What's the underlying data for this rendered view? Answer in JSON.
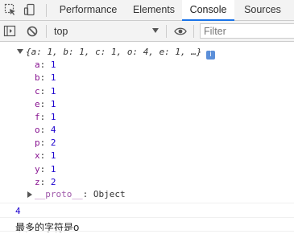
{
  "devtools": {
    "tabs": [
      {
        "label": "Performance"
      },
      {
        "label": "Elements"
      },
      {
        "label": "Console",
        "active": true
      },
      {
        "label": "Sources"
      }
    ]
  },
  "toolbar": {
    "context": "top",
    "filter_placeholder": "Filter"
  },
  "console": {
    "object_preview": "{a: 1, b: 1, c: 1, o: 4, e: 1, …}",
    "info_badge": "i",
    "properties": [
      {
        "key": "a",
        "value": "1"
      },
      {
        "key": "b",
        "value": "1"
      },
      {
        "key": "c",
        "value": "1"
      },
      {
        "key": "e",
        "value": "1"
      },
      {
        "key": "f",
        "value": "1"
      },
      {
        "key": "o",
        "value": "4"
      },
      {
        "key": "p",
        "value": "2"
      },
      {
        "key": "x",
        "value": "1"
      },
      {
        "key": "y",
        "value": "1"
      },
      {
        "key": "z",
        "value": "2"
      }
    ],
    "proto_key": "__proto__",
    "proto_value": "Object",
    "result_value": "4",
    "message": "最多的字符是o"
  },
  "colors": {
    "key": "#881391",
    "number": "#1c00cf",
    "active_tab_underline": "#1a73e8"
  }
}
